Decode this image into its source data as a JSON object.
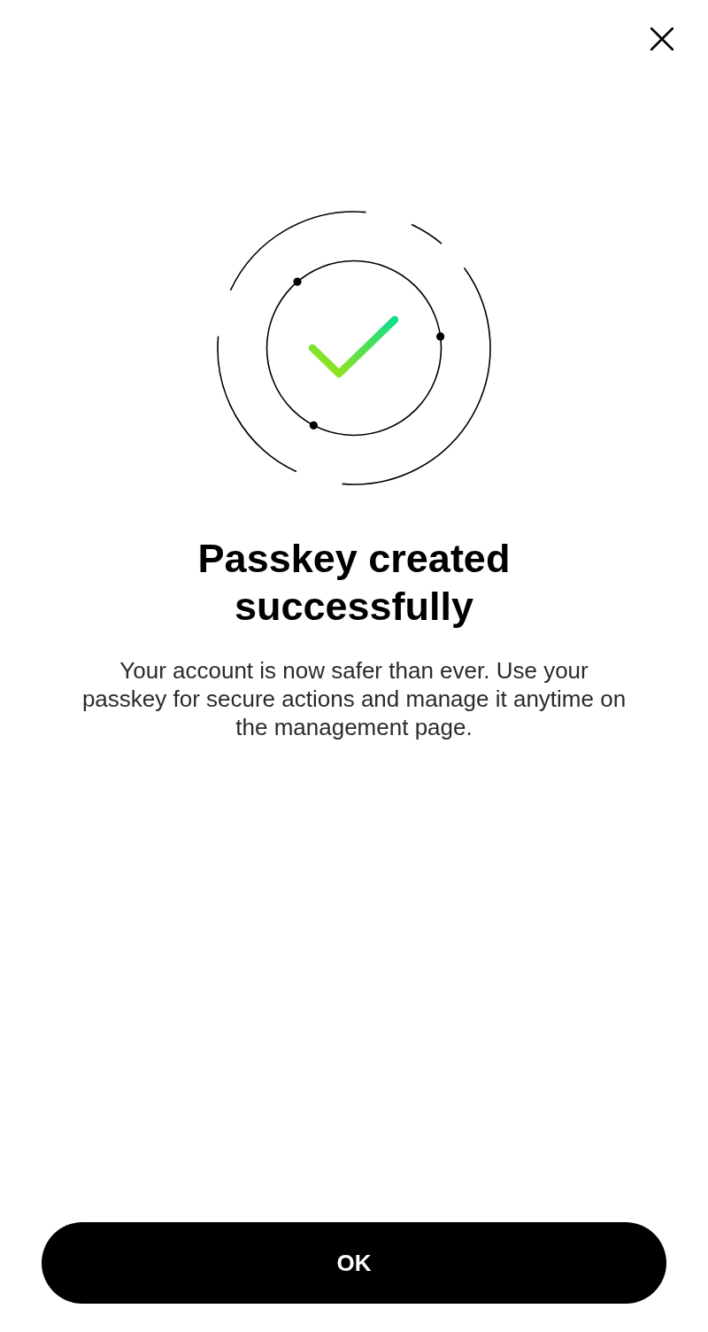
{
  "screen": {
    "title": "Passkey created successfully",
    "message": "Your account is now safer than ever. Use your passkey for secure actions and manage it anytime on the management page."
  },
  "primary_button": {
    "label": "OK"
  }
}
